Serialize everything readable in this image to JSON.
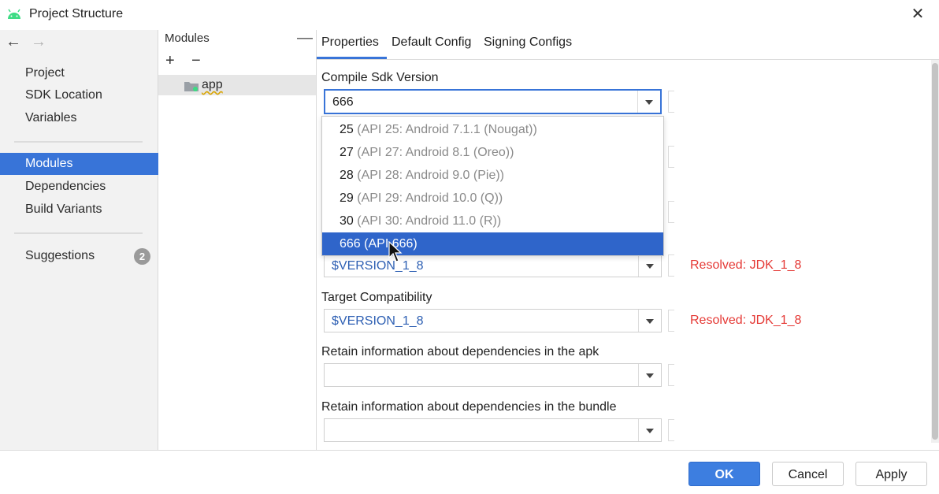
{
  "window": {
    "title": "Project Structure",
    "close_glyph": "✕"
  },
  "nav": {
    "back_glyph": "←",
    "forward_glyph": "→"
  },
  "sidebar": {
    "items": [
      {
        "label": "Project"
      },
      {
        "label": "SDK Location"
      },
      {
        "label": "Variables"
      },
      {
        "label": "Modules",
        "selected": true
      },
      {
        "label": "Dependencies"
      },
      {
        "label": "Build Variants"
      },
      {
        "label": "Suggestions",
        "badge": "2"
      }
    ]
  },
  "modules": {
    "title": "Modules",
    "collapse_glyph": "—",
    "add_glyph": "+",
    "remove_glyph": "−",
    "items": [
      {
        "label": "app"
      }
    ]
  },
  "tabs": [
    {
      "label": "Properties",
      "active": true
    },
    {
      "label": "Default Config"
    },
    {
      "label": "Signing Configs"
    }
  ],
  "form": {
    "compile_sdk": {
      "label": "Compile Sdk Version",
      "value": "666"
    },
    "source_compat": {
      "value": "$VERSION_1_8",
      "resolved": "Resolved: JDK_1_8"
    },
    "target_compat": {
      "label": "Target Compatibility",
      "value": "$VERSION_1_8",
      "resolved": "Resolved: JDK_1_8"
    },
    "deps_apk": {
      "label": "Retain information about dependencies in the apk",
      "value": ""
    },
    "deps_bundle": {
      "label": "Retain information about dependencies in the bundle",
      "value": ""
    }
  },
  "dropdown": {
    "options": [
      {
        "num": "25",
        "desc": "(API 25: Android 7.1.1 (Nougat))"
      },
      {
        "num": "27",
        "desc": "(API 27: Android 8.1 (Oreo))"
      },
      {
        "num": "28",
        "desc": "(API 28: Android 9.0 (Pie))"
      },
      {
        "num": "29",
        "desc": "(API 29: Android 10.0 (Q))"
      },
      {
        "num": "30",
        "desc": "(API 30: Android 11.0 (R))"
      },
      {
        "num": "666",
        "desc": "(API 666)",
        "selected": true
      }
    ]
  },
  "footer": {
    "ok": "OK",
    "cancel": "Cancel",
    "apply": "Apply"
  },
  "colors": {
    "accent": "#3874d8",
    "selection": "#2f65ca",
    "resolved": "#e53935",
    "variable": "#2d5fb3"
  }
}
